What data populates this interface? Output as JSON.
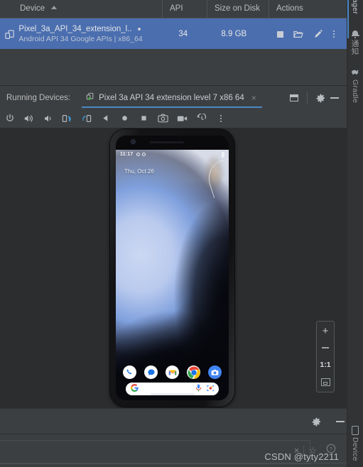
{
  "device_manager": {
    "columns": [
      "Device",
      "API",
      "Size on Disk",
      "Actions"
    ],
    "sort_column": "Device",
    "sort_direction": "asc",
    "rows": [
      {
        "icon": "virtual-device-icon",
        "name": "Pixel_3a_API_34_extension_l...",
        "subtitle": "Android API 34 Google APIs | x86_64",
        "api": "34",
        "size_on_disk": "8.9 GB",
        "running_indicator": "•",
        "actions": [
          "stop-icon",
          "folder-icon",
          "edit-icon",
          "more-icon"
        ]
      }
    ]
  },
  "running_devices": {
    "label": "Running Devices:",
    "tab": {
      "icon": "device-running-icon",
      "title": "Pixel 3a API 34 extension level 7 x86 64",
      "close": "×"
    },
    "window_controls": [
      "window-icon",
      "settings-gear-icon",
      "minimize-icon"
    ]
  },
  "emulator_toolbar": {
    "buttons": [
      "power-icon",
      "volume-up-icon",
      "volume-down-icon",
      "rotate-left-icon",
      "rotate-right-icon",
      "back-icon",
      "home-icon",
      "overview-icon",
      "screenshot-icon",
      "record-icon",
      "history-icon",
      "more-icon"
    ]
  },
  "emulator": {
    "device_model": "Pixel 3a",
    "status_bar": {
      "time": "11:17",
      "icons": [
        "circle-icon",
        "circle-icon"
      ],
      "battery": "battery-icon"
    },
    "date_widget": "Thu, Oct 26",
    "dock_apps": [
      {
        "name": "Phone",
        "icon": "phone-app-icon"
      },
      {
        "name": "Messages",
        "icon": "messages-app-icon"
      },
      {
        "name": "Gmail",
        "icon": "gmail-app-icon"
      },
      {
        "name": "Chrome",
        "icon": "chrome-app-icon"
      },
      {
        "name": "Camera",
        "icon": "camera-app-icon"
      }
    ],
    "search_bar": {
      "logo": "google-g-icon",
      "mic": "microphone-icon",
      "lens": "google-lens-icon"
    }
  },
  "zoom_controls": {
    "zoom_in": "+",
    "zoom_out": "−",
    "actual_size": "1:1",
    "fit_to_screen": "fit-screen-icon"
  },
  "bottom_bar": {
    "settings": "settings-gear-icon",
    "minimize": "minimize-icon",
    "close": "×",
    "favorite": "☆",
    "help": "?"
  },
  "watermark": "CSDN @tyty2211",
  "right_sidebar": {
    "items": [
      {
        "id": "device-manager",
        "label": "ager",
        "icon": null,
        "selected": true
      },
      {
        "id": "notifications",
        "label": "通知",
        "icon": "bell-icon",
        "selected": false
      },
      {
        "id": "gradle",
        "label": "Gradle",
        "icon": "gradle-elephant-icon",
        "selected": false
      },
      {
        "id": "device-file-explorer",
        "label": "Device",
        "icon": "device-icon",
        "selected": false
      }
    ]
  },
  "colors": {
    "panel_bg": "#3c3f41",
    "row_selected": "#4b6eaf",
    "accent": "#4a88c7",
    "sidebar_bg": "#313335",
    "text_primary": "#bbbbbb",
    "emulator_bg": "#2b2d2e"
  }
}
